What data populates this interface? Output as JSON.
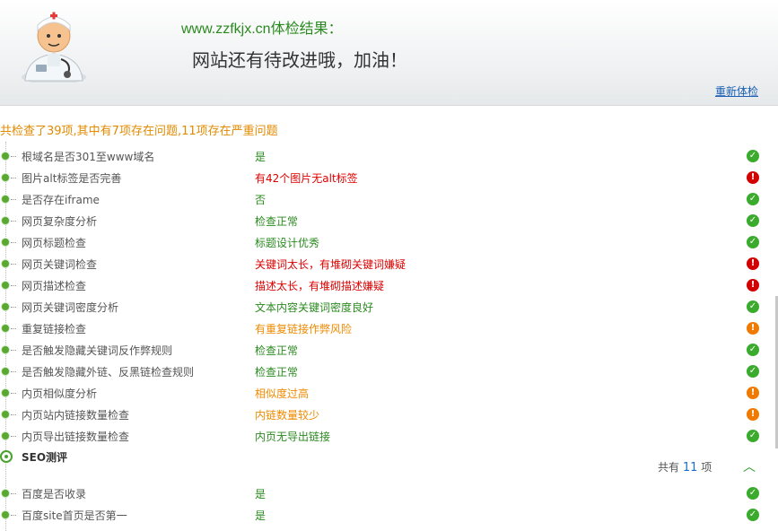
{
  "header": {
    "site_title": "www.zzfkjx.cn体检结果：",
    "verdict": "网站还有待改进哦，加油！",
    "recheck": "重新体检"
  },
  "summary": "共检查了39项,其中有7项存在问题,11项存在严重问题",
  "items_a": [
    {
      "name": "根域名是否301至www域名",
      "result": "是",
      "status": "ok"
    },
    {
      "name": "图片alt标签是否完善",
      "result": "有42个图片无alt标签",
      "status": "bad"
    },
    {
      "name": "是否存在iframe",
      "result": "否",
      "status": "ok"
    },
    {
      "name": "网页复杂度分析",
      "result": "检查正常",
      "status": "ok"
    },
    {
      "name": "网页标题检查",
      "result": "标题设计优秀",
      "status": "ok"
    },
    {
      "name": "网页关键词检查",
      "result": "关键词太长，有堆砌关键词嫌疑",
      "status": "bad"
    },
    {
      "name": "网页描述检查",
      "result": "描述太长，有堆砌描述嫌疑",
      "status": "bad"
    },
    {
      "name": "网页关键词密度分析",
      "result": "文本内容关键词密度良好",
      "status": "ok"
    },
    {
      "name": "重复链接检查",
      "result": "有重复链接作弊风险",
      "status": "warn"
    },
    {
      "name": "是否触发隐藏关键词反作弊规则",
      "result": "检查正常",
      "status": "ok"
    },
    {
      "name": "是否触发隐藏外链、反黑链检查规则",
      "result": "检查正常",
      "status": "ok"
    },
    {
      "name": "内页相似度分析",
      "result": "相似度过高",
      "status": "warn"
    },
    {
      "name": "内页站内链接数量检查",
      "result": "内链数量较少",
      "status": "warn"
    },
    {
      "name": "内页导出链接数量检查",
      "result": "内页无导出链接",
      "status": "ok"
    }
  ],
  "seo_section": {
    "title": "SEO测评",
    "count_prefix": "共有",
    "count": "11",
    "count_suffix": "项"
  },
  "items_b": [
    {
      "name": "百度是否收录",
      "result": "是",
      "status": "ok"
    },
    {
      "name": "百度site首页是否第一",
      "result": "是",
      "status": "ok"
    }
  ],
  "icons": {
    "ok": "check-icon",
    "bad": "exclamation-icon",
    "warn": "exclamation-icon"
  },
  "colors": {
    "ok": "#2a8a1f",
    "bad": "#e00000",
    "warn": "#ef8a00",
    "accent": "#1a6fc4"
  }
}
